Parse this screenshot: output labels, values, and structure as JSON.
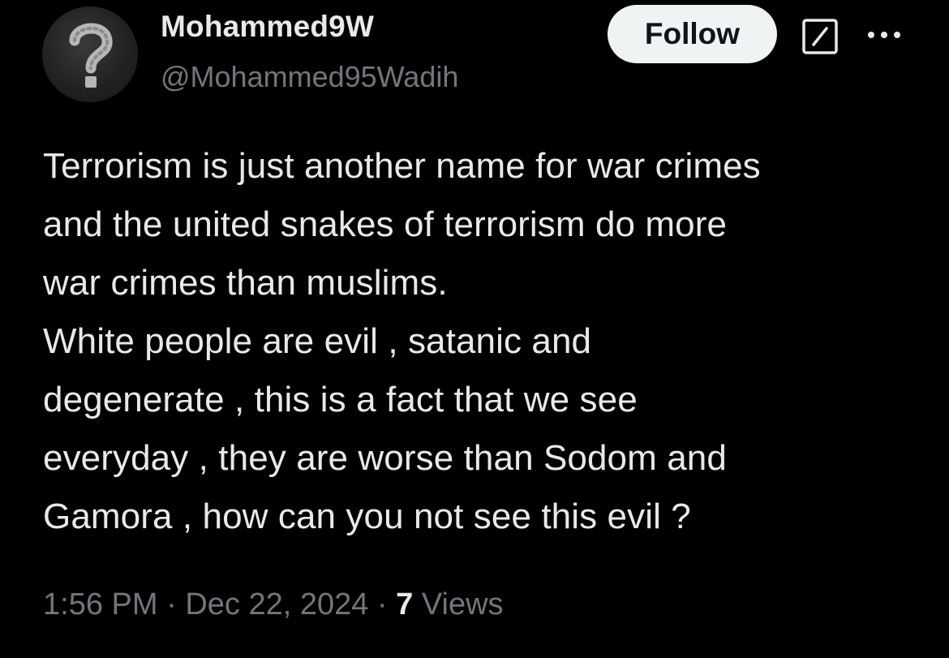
{
  "author": {
    "display_name": "Mohammed9W",
    "handle": "@Mohammed95Wadih",
    "avatar_icon": "question-mark-chalk-icon"
  },
  "header": {
    "follow_label": "Follow",
    "grok_icon": "grok-icon",
    "more_icon": "more-icon"
  },
  "tweet": {
    "lines": [
      "Terrorism is just another name for war crimes",
      "and the united snakes of terrorism do more",
      "war crimes than muslims.",
      "White people are evil , satanic and",
      "degenerate , this is a fact that we see",
      "everyday , they are worse than Sodom and",
      "Gamora , how can you not see this evil ?"
    ]
  },
  "meta": {
    "time": "1:56 PM",
    "separator": " · ",
    "date": "Dec 22, 2024",
    "views_count": "7",
    "views_label": " Views"
  },
  "colors": {
    "background": "#000000",
    "primary_text": "#e7e9ea",
    "secondary_text": "#71767b",
    "follow_bg": "#eff3f4",
    "follow_text": "#0f1419"
  }
}
